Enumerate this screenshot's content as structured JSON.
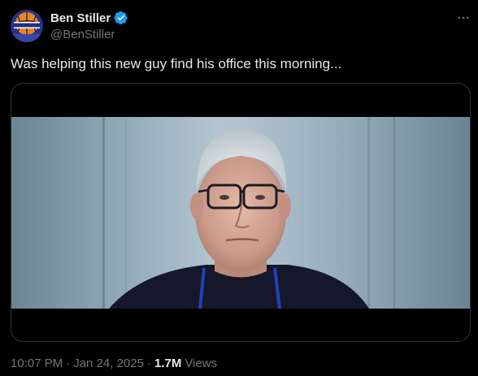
{
  "author": {
    "display_name": "Ben Stiller",
    "handle": "@BenStiller",
    "verified": true
  },
  "tweet": {
    "text": "Was helping this new guy find his office this morning..."
  },
  "meta": {
    "time": "10:07 PM",
    "separator1": "·",
    "date": "Jan 24, 2025",
    "separator2": "·",
    "views_count": "1.7M",
    "views_label": "Views"
  },
  "colors": {
    "background": "#000000",
    "text_primary": "#e7e9ea",
    "text_secondary": "#71767b",
    "verified_badge": "#1d9bf0",
    "border": "#2f3336"
  },
  "icons": {
    "verified": "verified-badge-icon",
    "more": "more-options-icon"
  }
}
